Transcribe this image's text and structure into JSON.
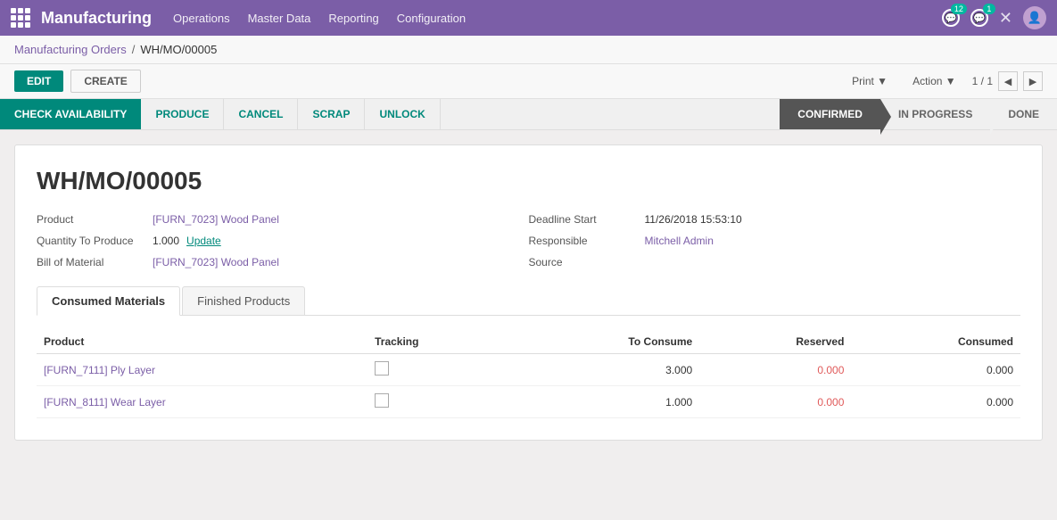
{
  "app": {
    "name": "Manufacturing"
  },
  "nav": {
    "items": [
      {
        "label": "Operations",
        "id": "operations"
      },
      {
        "label": "Master Data",
        "id": "master-data"
      },
      {
        "label": "Reporting",
        "id": "reporting"
      },
      {
        "label": "Configuration",
        "id": "configuration"
      }
    ]
  },
  "icons": {
    "updates_badge": "12",
    "messages_badge": "1"
  },
  "breadcrumb": {
    "parent": "Manufacturing Orders",
    "separator": "/",
    "current": "WH/MO/00005"
  },
  "toolbar": {
    "edit_label": "EDIT",
    "create_label": "CREATE",
    "print_label": "Print",
    "action_label": "Action",
    "pager": "1 / 1"
  },
  "status_bar": {
    "check_availability": "CHECK AVAILABILITY",
    "produce": "PRODUCE",
    "cancel": "CANCEL",
    "scrap": "SCRAP",
    "unlock": "UNLOCK",
    "steps": [
      {
        "label": "CONFIRMED",
        "active": true
      },
      {
        "label": "IN PROGRESS",
        "active": false
      },
      {
        "label": "DONE",
        "active": false
      }
    ]
  },
  "form": {
    "title": "WH/MO/00005",
    "fields": {
      "product_label": "Product",
      "product_value": "[FURN_7023] Wood Panel",
      "quantity_label": "Quantity To Produce",
      "quantity_value": "1.000",
      "update_label": "Update",
      "bom_label": "Bill of Material",
      "bom_value": "[FURN_7023] Wood Panel",
      "deadline_label": "Deadline Start",
      "deadline_value": "11/26/2018 15:53:10",
      "responsible_label": "Responsible",
      "responsible_value": "Mitchell Admin",
      "source_label": "Source",
      "source_value": ""
    }
  },
  "tabs": [
    {
      "label": "Consumed Materials",
      "active": true
    },
    {
      "label": "Finished Products",
      "active": false
    }
  ],
  "table": {
    "columns": [
      {
        "label": "Product",
        "align": "left"
      },
      {
        "label": "Tracking",
        "align": "left"
      },
      {
        "label": "To Consume",
        "align": "right"
      },
      {
        "label": "Reserved",
        "align": "right"
      },
      {
        "label": "Consumed",
        "align": "right"
      }
    ],
    "rows": [
      {
        "product": "[FURN_7111] Ply Layer",
        "tracking": "",
        "to_consume": "3.000",
        "reserved": "0.000",
        "consumed": "0.000"
      },
      {
        "product": "[FURN_8111] Wear Layer",
        "tracking": "",
        "to_consume": "1.000",
        "reserved": "0.000",
        "consumed": "0.000"
      }
    ]
  }
}
